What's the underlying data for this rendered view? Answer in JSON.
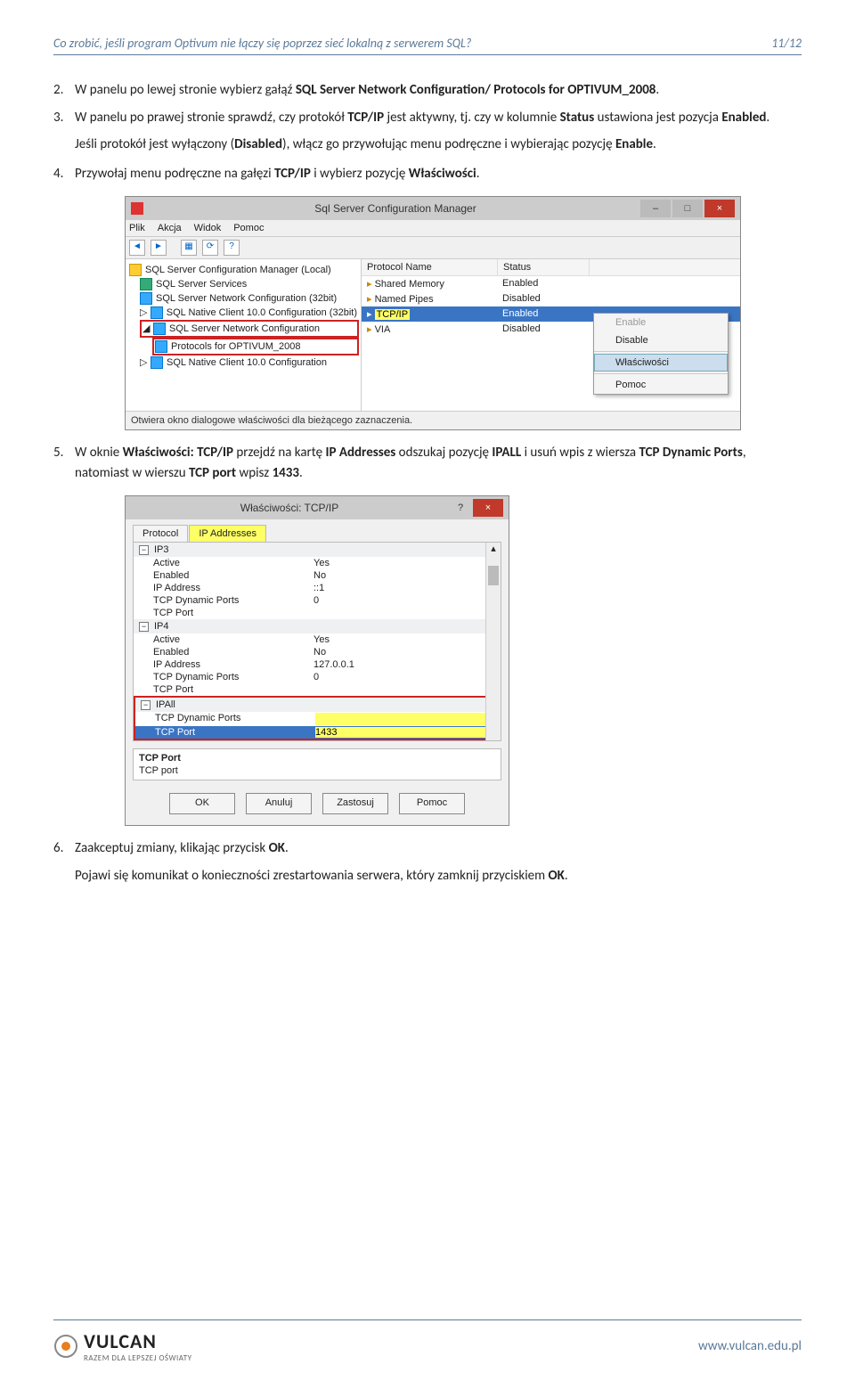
{
  "header": {
    "title": "Co zrobić, jeśli program Optivum nie łączy się poprzez sieć lokalną z serwerem SQL?",
    "page": "11/12"
  },
  "steps": {
    "s2_num": "2.",
    "s2_txt_a": "W panelu po lewej stronie wybierz gałąź ",
    "s2_txt_b": "SQL Server Network Configuration/ Protocols for OPTIVUM_2008",
    "s2_txt_c": ".",
    "s3_num": "3.",
    "s3_txt_a": "W panelu po prawej stronie sprawdź, czy protokół ",
    "s3_txt_b": "TCP/IP",
    "s3_txt_c": " jest aktywny, tj. czy w kolumnie ",
    "s3_txt_d": "Status",
    "s3_txt_e": " ustawiona jest pozycja ",
    "s3_txt_f": "Enabled",
    "s3_txt_g": ".",
    "s3b_a": "Jeśli protokół jest wyłączony (",
    "s3b_b": "Disabled",
    "s3b_c": "), włącz go przywołując menu podręczne i wybierając pozycję ",
    "s3b_d": "Enable",
    "s3b_e": ".",
    "s4_num": "4.",
    "s4_a": "Przywołaj menu podręczne na gałęzi ",
    "s4_b": "TCP/IP",
    "s4_c": " i wybierz pozycję ",
    "s4_d": "Właściwości",
    "s4_e": ".",
    "s5_num": "5.",
    "s5_a": "W oknie ",
    "s5_b": "Właściwości: TCP/IP",
    "s5_c": " przejdź na kartę ",
    "s5_d": "IP Addresses",
    "s5_e": " odszukaj pozycję ",
    "s5_f": "IPALL",
    "s5_g": " i usuń wpis z wiersza ",
    "s5_h": "TCP Dynamic Ports",
    "s5_i": ", natomiast w wierszu ",
    "s5_j": "TCP port",
    "s5_k": " wpisz ",
    "s5_l": "1433",
    "s5_m": ".",
    "s6_num": "6.",
    "s6_a": "Zaakceptuj zmiany, klikając przycisk ",
    "s6_b": "OK",
    "s6_c": ".",
    "s6b_a": "Pojawi się komunikat o konieczności zrestartowania serwera, który zamknij przyciskiem ",
    "s6b_b": "OK",
    "s6b_c": "."
  },
  "win1": {
    "title": "Sql Server Configuration Manager",
    "menu": [
      "Plik",
      "Akcja",
      "Widok",
      "Pomoc"
    ],
    "tree": [
      "SQL Server Configuration Manager (Local)",
      "SQL Server Services",
      "SQL Server Network Configuration (32bit)",
      "SQL Native Client 10.0 Configuration (32bit)",
      "SQL Server Network Configuration",
      "Protocols for OPTIVUM_2008",
      "SQL Native Client 10.0 Configuration"
    ],
    "list_head": [
      "Protocol Name",
      "Status"
    ],
    "list_rows": [
      {
        "n": "Shared Memory",
        "s": "Enabled"
      },
      {
        "n": "Named Pipes",
        "s": "Disabled"
      },
      {
        "n": "TCP/IP",
        "s": "Enabled"
      },
      {
        "n": "VIA",
        "s": "Disabled"
      }
    ],
    "ctx": [
      "Enable",
      "Disable",
      "Właściwości",
      "Pomoc"
    ],
    "status": "Otwiera okno dialogowe właściwości dla bieżącego zaznaczenia."
  },
  "win2": {
    "title": "Właściwości: TCP/IP",
    "tabs": [
      "Protocol",
      "IP Addresses"
    ],
    "sections": {
      "ip3": {
        "name": "IP3",
        "rows": [
          {
            "k": "Active",
            "v": "Yes"
          },
          {
            "k": "Enabled",
            "v": "No"
          },
          {
            "k": "IP Address",
            "v": "::1"
          },
          {
            "k": "TCP Dynamic Ports",
            "v": "0"
          },
          {
            "k": "TCP Port",
            "v": ""
          }
        ]
      },
      "ip4": {
        "name": "IP4",
        "rows": [
          {
            "k": "Active",
            "v": "Yes"
          },
          {
            "k": "Enabled",
            "v": "No"
          },
          {
            "k": "IP Address",
            "v": "127.0.0.1"
          },
          {
            "k": "TCP Dynamic Ports",
            "v": "0"
          },
          {
            "k": "TCP Port",
            "v": ""
          }
        ]
      },
      "ipall": {
        "name": "IPAll",
        "rows": [
          {
            "k": "TCP Dynamic Ports",
            "v": ""
          },
          {
            "k": "TCP Port",
            "v": "1433"
          }
        ]
      }
    },
    "desc": [
      "TCP Port",
      "TCP port"
    ],
    "buttons": [
      "OK",
      "Anuluj",
      "Zastosuj",
      "Pomoc"
    ]
  },
  "footer": {
    "brand": "VULCAN",
    "tagline": "RAZEM DLA LEPSZEJ OŚWIATY",
    "url": "www.vulcan.edu.pl"
  }
}
